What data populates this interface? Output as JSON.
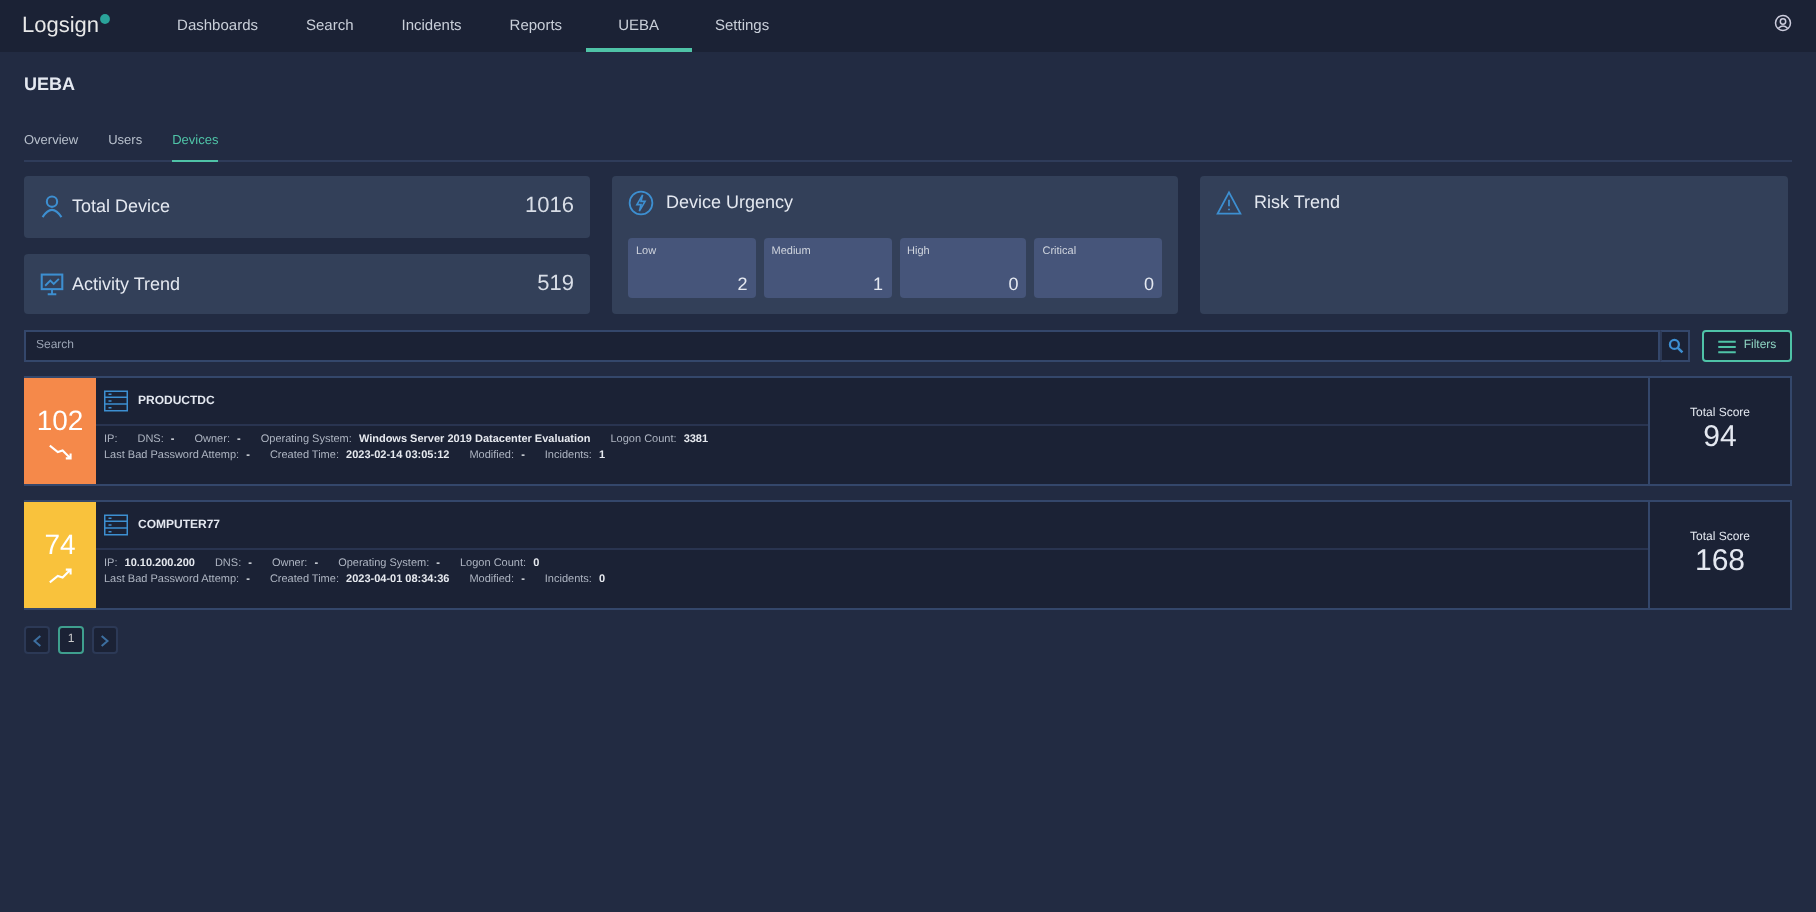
{
  "nav": {
    "logo": "Logsign",
    "items": [
      {
        "label": "Dashboards",
        "selected": false
      },
      {
        "label": "Search",
        "selected": false
      },
      {
        "label": "Incidents",
        "selected": false
      },
      {
        "label": "Reports",
        "selected": false
      },
      {
        "label": "UEBA",
        "selected": true
      },
      {
        "label": "Settings",
        "selected": false
      }
    ]
  },
  "page_title": "UEBA",
  "subtabs": [
    {
      "label": "Overview",
      "selected": false
    },
    {
      "label": "Users",
      "selected": false
    },
    {
      "label": "Devices",
      "selected": true
    }
  ],
  "summary": [
    {
      "kind": "user",
      "label": "Total Device",
      "value": "1016"
    },
    {
      "kind": "trend",
      "label": "Activity Trend",
      "value": "519"
    }
  ],
  "urgency": {
    "title": "Device Urgency",
    "levels": [
      {
        "label": "Low",
        "value": "2"
      },
      {
        "label": "Medium",
        "value": "1"
      },
      {
        "label": "High",
        "value": "0"
      },
      {
        "label": "Critical",
        "value": "0"
      }
    ]
  },
  "risk_trend": {
    "title": "Risk Trend"
  },
  "search": {
    "placeholder": "Search"
  },
  "filters_button": "Filters",
  "devices": [
    {
      "score": "102",
      "color": "#f5894a",
      "kind": "falling",
      "name": "PRODUCTDC",
      "line1": [
        {
          "label": "IP:"
        },
        {
          "label": "DNS:",
          "value": "-"
        },
        {
          "label": "Owner:",
          "value": "-"
        },
        {
          "label": "Operating System:",
          "value": "Windows Server 2019 Datacenter Evaluation"
        },
        {
          "label": "Logon Count:",
          "value": "3381"
        }
      ],
      "line2": [
        {
          "label": "Last Bad Password Attemp:",
          "value": "-"
        },
        {
          "label": "Created Time:",
          "value": "2023-02-14 03:05:12"
        },
        {
          "label": "Modified:",
          "value": "-"
        },
        {
          "label": "Incidents:",
          "value": "1"
        }
      ],
      "total_label": "Total Score",
      "total": "94"
    },
    {
      "score": "74",
      "color": "#f9c23c",
      "kind": "rising",
      "name": "COMPUTER77",
      "line1": [
        {
          "label": "IP:",
          "value": "10.10.200.200"
        },
        {
          "label": "DNS:",
          "value": "-"
        },
        {
          "label": "Owner:",
          "value": "-"
        },
        {
          "label": "Operating System:",
          "value": "-"
        },
        {
          "label": "Logon Count:",
          "value": "0"
        }
      ],
      "line2": [
        {
          "label": "Last Bad Password Attemp:",
          "value": "-"
        },
        {
          "label": "Created Time:",
          "value": "2023-04-01 08:34:36"
        },
        {
          "label": "Modified:",
          "value": "-"
        },
        {
          "label": "Incidents:",
          "value": "0"
        }
      ],
      "total_label": "Total Score",
      "total": "168"
    }
  ],
  "pagination": {
    "pages": [
      {
        "label": "1",
        "selected": true
      }
    ]
  }
}
